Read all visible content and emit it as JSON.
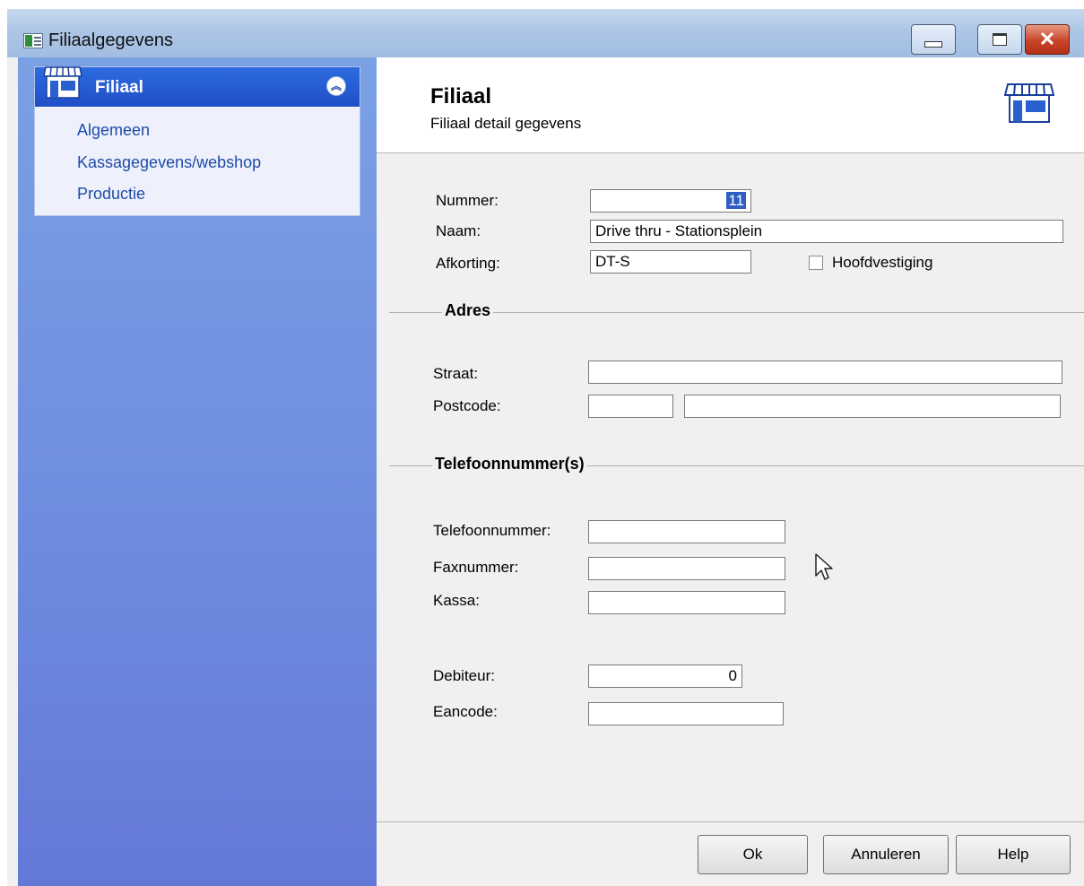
{
  "window": {
    "title": "Filiaalgegevens",
    "controls": {
      "minimize": "minimize-icon",
      "maximize": "maximize-icon",
      "close": "close-icon"
    }
  },
  "sidebar": {
    "title": "Filiaal",
    "items": [
      {
        "label": "Algemeen"
      },
      {
        "label": "Kassagegevens/webshop"
      },
      {
        "label": "Productie"
      }
    ]
  },
  "header": {
    "title": "Filiaal",
    "subtitle": "Filiaal detail gegevens"
  },
  "form": {
    "nummer": {
      "label": "Nummer:",
      "value": "11"
    },
    "naam": {
      "label": "Naam:",
      "value": "Drive thru - Stationsplein"
    },
    "afkorting": {
      "label": "Afkorting:",
      "value": "DT-S"
    },
    "hoofdvestiging": {
      "label": "Hoofdvestiging",
      "checked": false
    },
    "adres": {
      "title": "Adres",
      "straat": {
        "label": "Straat:",
        "value": ""
      },
      "postcode": {
        "label": "Postcode:",
        "value": "",
        "plaats": ""
      }
    },
    "telefoon": {
      "title": "Telefoonnummer(s)",
      "telefoonnummer": {
        "label": "Telefoonnummer:",
        "value": ""
      },
      "faxnummer": {
        "label": "Faxnummer:",
        "value": ""
      },
      "kassa": {
        "label": "Kassa:",
        "value": ""
      }
    },
    "debiteur": {
      "label": "Debiteur:",
      "value": "0"
    },
    "eancode": {
      "label": "Eancode:",
      "value": ""
    }
  },
  "buttons": {
    "ok": "Ok",
    "cancel": "Annuleren",
    "help": "Help"
  },
  "colors": {
    "sidebar_accent": "#1f4fc6",
    "selection": "#2f5dc4",
    "close_button": "#c8442a"
  }
}
